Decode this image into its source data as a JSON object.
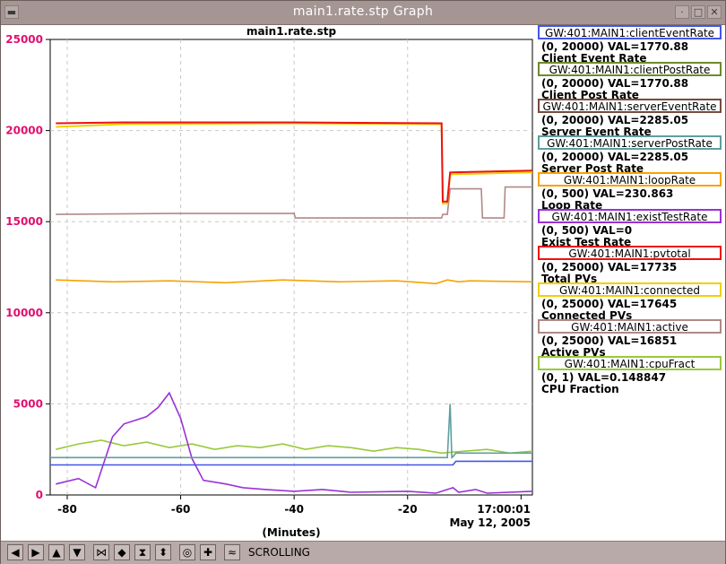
{
  "window": {
    "title": "main1.rate.stp Graph"
  },
  "chart_data": {
    "type": "line",
    "title": "main1.rate.stp",
    "xlabel": "(Minutes)",
    "xlim": [
      -83,
      2
    ],
    "ylim": [
      0,
      25000
    ],
    "y_ticks": [
      0,
      5000,
      10000,
      15000,
      20000,
      25000
    ],
    "y_tick_labels": [
      "0",
      "5000",
      "10000",
      "15000",
      "20000",
      "25000"
    ],
    "x_ticks": [
      -80,
      -60,
      -40,
      -20,
      0
    ],
    "x_tick_labels": [
      "-80",
      "-60",
      "-40",
      "-20",
      "17:00:01"
    ],
    "date_label": "May 12, 2005",
    "grid": true,
    "legend_placement": "right",
    "series": [
      {
        "name": "GW:401:MAIN1:clientEventRate",
        "range": "(0, 20000) VAL=1770.88",
        "desc": "Client Event Rate",
        "color": "#4455e8",
        "x": [
          -83,
          -12,
          -11.5,
          2
        ],
        "y": [
          1650,
          1650,
          1850,
          1850
        ]
      },
      {
        "name": "GW:401:MAIN1:clientPostRate",
        "range": "(0, 20000) VAL=1770.88",
        "desc": "Client Post Rate",
        "color": "#6e8a2a",
        "x": [],
        "y": []
      },
      {
        "name": "GW:401:MAIN1:serverEventRate",
        "range": "(0, 20000) VAL=2285.05",
        "desc": "Server Event Rate",
        "color": "#7a4a3e",
        "x": [],
        "y": []
      },
      {
        "name": "GW:401:MAIN1:serverPostRate",
        "range": "(0, 20000) VAL=2285.05",
        "desc": "Server Post Rate",
        "color": "#5f9ea0",
        "x": [
          -83,
          -13,
          -12.5,
          -12.2,
          -12,
          -11.5,
          2
        ],
        "y": [
          2050,
          2050,
          5000,
          2050,
          2100,
          2300,
          2300
        ]
      },
      {
        "name": "GW:401:MAIN1:loopRate",
        "range": "(0, 500) VAL=230.863",
        "desc": "Loop Rate",
        "color": "#f5a300",
        "x": [
          -82,
          -72,
          -62,
          -52,
          -42,
          -32,
          -22,
          -15,
          -13,
          -11,
          -9,
          2
        ],
        "y": [
          11800,
          11700,
          11750,
          11650,
          11800,
          11700,
          11750,
          11600,
          11800,
          11700,
          11750,
          11700
        ]
      },
      {
        "name": "GW:401:MAIN1:existTestRate",
        "range": "(0, 500) VAL=0",
        "desc": "Exist Test Rate",
        "color": "#9b30d8",
        "x": [
          -82,
          -78,
          -75,
          -72,
          -70,
          -66,
          -64,
          -62,
          -60,
          -58,
          -56,
          -52,
          -49,
          -45,
          -40,
          -35,
          -30,
          -20,
          -15,
          -12,
          -11,
          -8,
          -6,
          2
        ],
        "y": [
          600,
          900,
          400,
          3200,
          3900,
          4300,
          4800,
          5600,
          4200,
          2000,
          800,
          600,
          400,
          300,
          200,
          300,
          150,
          200,
          100,
          400,
          150,
          300,
          100,
          200
        ]
      },
      {
        "name": "GW:401:MAIN1:pvtotal",
        "range": "(0, 25000) VAL=17735",
        "desc": "Total PVs",
        "color": "#ee1111",
        "x": [
          -82,
          -70,
          -40,
          -14,
          -13.8,
          -13,
          -12.5,
          2
        ],
        "y": [
          20400,
          20450,
          20450,
          20400,
          16100,
          16100,
          17700,
          17800
        ]
      },
      {
        "name": "GW:401:MAIN1:connected",
        "range": "(0, 25000)  VAL=17645",
        "desc": "Connected PVs",
        "color": "#f0d000",
        "x": [
          -82,
          -70,
          -40,
          -14,
          -13.8,
          -13,
          -12.5,
          2
        ],
        "y": [
          20200,
          20350,
          20400,
          20350,
          16000,
          16000,
          17600,
          17700
        ]
      },
      {
        "name": "GW:401:MAIN1:active",
        "range": "(0, 25000)  VAL=16851",
        "desc": "Active PVs",
        "color": "#b08a86",
        "x": [
          -82,
          -62,
          -40,
          -39.8,
          -14,
          -13.8,
          -13,
          -12.5,
          -7,
          -6.8,
          -3,
          -2.8,
          2
        ],
        "y": [
          15400,
          15450,
          15450,
          15200,
          15200,
          15400,
          15400,
          16800,
          16800,
          15200,
          15200,
          16900,
          16900
        ]
      },
      {
        "name": "GW:401:MAIN1:cpuFract",
        "range": "(0, 1) VAL=0.148847",
        "desc": "CPU Fraction",
        "color": "#99c93c",
        "x": [
          -82,
          -78,
          -74,
          -70,
          -66,
          -62,
          -58,
          -54,
          -50,
          -46,
          -42,
          -38,
          -34,
          -30,
          -26,
          -22,
          -18,
          -14,
          -10,
          -6,
          -2,
          2
        ],
        "y": [
          2500,
          2800,
          3000,
          2700,
          2900,
          2600,
          2800,
          2500,
          2700,
          2600,
          2800,
          2500,
          2700,
          2600,
          2400,
          2600,
          2500,
          2300,
          2400,
          2500,
          2300,
          2400
        ]
      }
    ]
  },
  "toolbar": {
    "scrolling_label": "SCROLLING",
    "buttons": [
      "arrow-left-icon",
      "arrow-right-icon",
      "arrow-up-icon",
      "arrow-down-icon",
      "zoom-in-x-icon",
      "zoom-out-x-icon",
      "zoom-in-y-icon",
      "zoom-out-y-icon",
      "circle-icon",
      "plus-icon",
      "autoscale-icon",
      "scroll-icon"
    ]
  }
}
